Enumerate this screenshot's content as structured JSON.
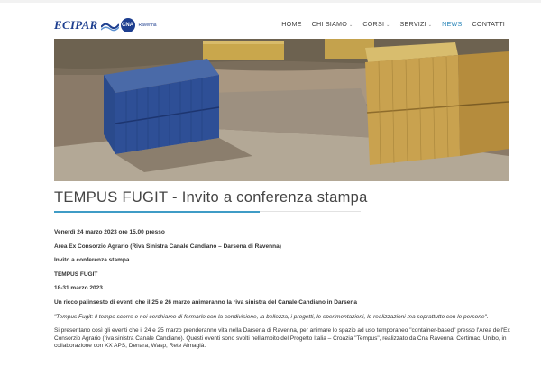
{
  "header": {
    "logo_text": "ECIPAR",
    "logo_badge": "CNA",
    "logo_city": "Ravenna",
    "nav": [
      {
        "label": "HOME",
        "has_caret": false
      },
      {
        "label": "CHI SIAMO",
        "has_caret": true
      },
      {
        "label": "CORSI",
        "has_caret": true
      },
      {
        "label": "SERVIZI",
        "has_caret": true
      },
      {
        "label": "NEWS",
        "has_caret": false,
        "active": true
      },
      {
        "label": "CONTATTI",
        "has_caret": false
      }
    ],
    "caret": "⌄"
  },
  "article": {
    "title": "TEMPUS FUGIT - Invito a conferenza stampa",
    "line1": "Venerdì 24 marzo 2023 ore 15.00 presso",
    "line2": "Area Ex Consorzio Agrario (Riva Sinistra Canale Candiano – Darsena di Ravenna)",
    "line3": "Invito a conferenza stampa",
    "line4": "TEMPUS FUGIT",
    "line5": "18-31 marzo 2023",
    "line6": "Un ricco palinsesto di eventi che il 25 e 26 marzo animeranno la riva sinistra del Canale Candiano in Darsena",
    "quote": "\"Tempus Fugit: il tempo scorre e noi cerchiamo di fermarlo con la condivisione, la bellezza, i progetti, le sperimentazioni, le realizzazioni ma soprattutto con le persone\".",
    "body": "Si presentano così gli eventi che il 24 e 25 marzo prenderanno vita nella Darsena di Ravenna, per animare lo spazio ad uso temporaneo \"container-based\" presso l'Area dell'Ex Consorzio Agrario (riva sinistra Canale Candiano). Questi eventi sono svolti nell'ambito del Progetto Italia – Croazia \"Tempus\", realizzato da Cna Ravenna, Certimac, Unibo, in collaborazione con XX APS, Denara, Wasp, Rete Almagià."
  },
  "colors": {
    "accent": "#3f9cc6",
    "logo": "#1d3e8f",
    "nav_active": "#2a85b8"
  }
}
